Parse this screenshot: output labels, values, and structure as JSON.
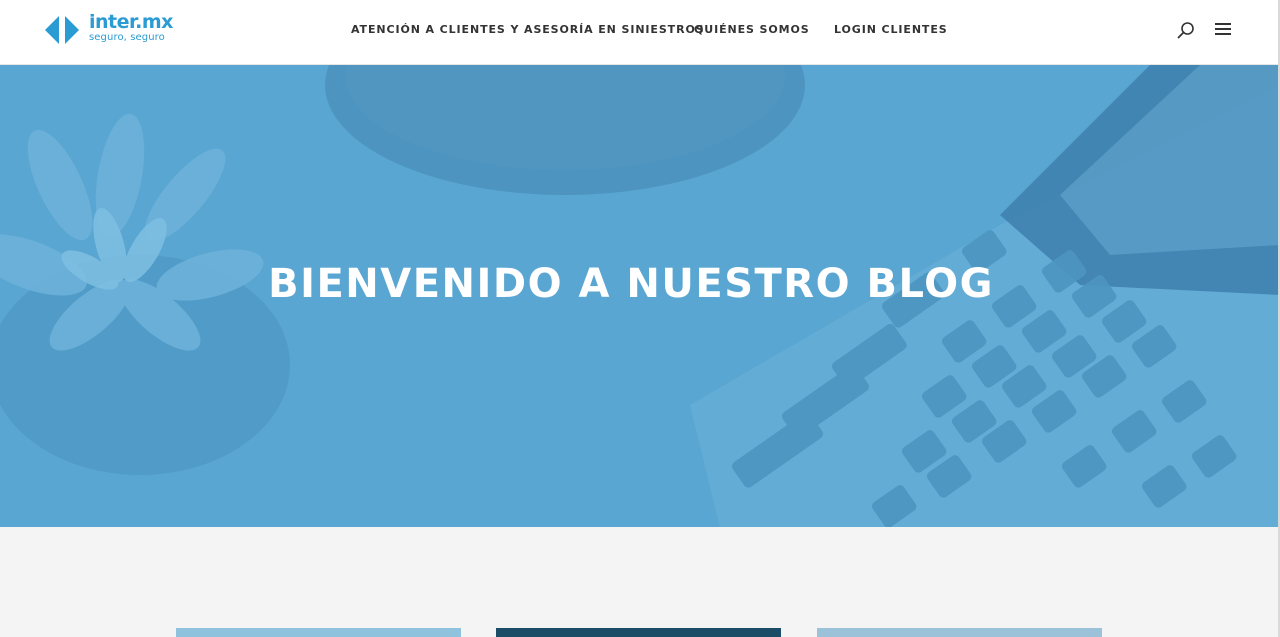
{
  "brand": {
    "name": "inter.mx",
    "tagline": "seguro, seguro",
    "color": "#2a9bd3"
  },
  "nav": {
    "items": [
      {
        "label": "ATENCIÓN A CLIENTES Y ASESORÍA EN SINIESTROS"
      },
      {
        "label": "QUIÉNES SOMOS"
      },
      {
        "label": "LOGIN CLIENTES"
      }
    ],
    "search_icon": "search-icon",
    "menu_icon": "hamburger-menu-icon"
  },
  "hero": {
    "title": "BIENVENIDO A NUESTRO BLOG",
    "overlay_color": "#5aa6d2"
  },
  "posts": {
    "thumbnail_colors": [
      "#8fc3dd",
      "#1c4d66",
      "#9cc2d9"
    ]
  }
}
